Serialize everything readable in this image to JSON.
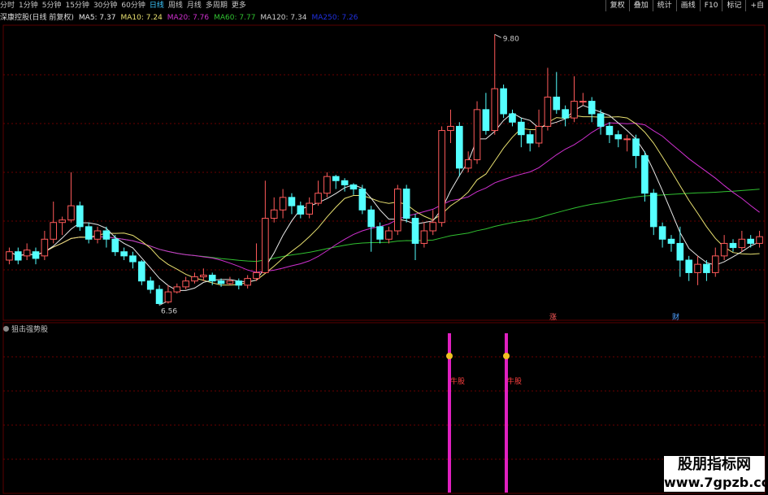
{
  "toolbar": {
    "periods": [
      "分时",
      "1分钟",
      "5分钟",
      "15分钟",
      "30分钟",
      "60分钟",
      "日线",
      "周线",
      "月线",
      "多周期",
      "更多"
    ],
    "active": "日线",
    "right_buttons": [
      "复权",
      "叠加",
      "统计",
      "画线",
      "F10",
      "标记",
      "+自"
    ]
  },
  "legend": {
    "title": "深康控股(日线 前复权)",
    "ma": [
      {
        "label": "MA5: 7.37",
        "color": "#e8e8e8"
      },
      {
        "label": "MA10: 7.24",
        "color": "#e8e070"
      },
      {
        "label": "MA20: 7.76",
        "color": "#d030d0"
      },
      {
        "label": "MA60: 7.77",
        "color": "#30c030"
      },
      {
        "label": "MA120: 7.34",
        "color": "#d0d0d0"
      },
      {
        "label": "MA250: 7.26",
        "color": "#2030e0"
      }
    ]
  },
  "annotations": {
    "high": "9.80",
    "low": "6.56",
    "tag1": "涨",
    "tag2": "财"
  },
  "panel2": {
    "title": "狙击强势股",
    "signal_text": "牛股"
  },
  "watermark": {
    "line1": "股朋指标网",
    "line2": "www.7gpzb.com"
  },
  "colors": {
    "up": "#ff5a5a",
    "down": "#54ffff",
    "grid": "#6a0000",
    "signal": "#e020c0",
    "ma5": "#e8e8e8",
    "ma10": "#e8e070",
    "ma20": "#d030d0",
    "ma60": "#30c030",
    "ma250": "#2030e0"
  },
  "chart_data": {
    "type": "candlestick",
    "ylim": [
      6.4,
      9.9
    ],
    "candles": [
      [
        7.1,
        7.2,
        7.25,
        7.05
      ],
      [
        7.2,
        7.1,
        7.25,
        7.05
      ],
      [
        7.15,
        7.22,
        7.3,
        7.1
      ],
      [
        7.2,
        7.12,
        7.25,
        7.05
      ],
      [
        7.15,
        7.35,
        7.45,
        7.1
      ],
      [
        7.35,
        7.55,
        7.8,
        7.3
      ],
      [
        7.55,
        7.58,
        7.62,
        7.4
      ],
      [
        7.58,
        7.75,
        8.15,
        7.55
      ],
      [
        7.75,
        7.5,
        7.8,
        7.45
      ],
      [
        7.5,
        7.35,
        7.55,
        7.3
      ],
      [
        7.35,
        7.45,
        7.5,
        7.3
      ],
      [
        7.45,
        7.35,
        7.5,
        7.25
      ],
      [
        7.35,
        7.2,
        7.4,
        7.15
      ],
      [
        7.2,
        7.15,
        7.25,
        7.1
      ],
      [
        7.15,
        7.08,
        7.2,
        7.0
      ],
      [
        7.08,
        6.85,
        7.1,
        6.8
      ],
      [
        6.85,
        6.75,
        6.9,
        6.7
      ],
      [
        6.75,
        6.58,
        6.8,
        6.56
      ],
      [
        6.6,
        6.72,
        6.8,
        6.58
      ],
      [
        6.72,
        6.78,
        6.82,
        6.7
      ],
      [
        6.78,
        6.85,
        6.9,
        6.75
      ],
      [
        6.85,
        6.9,
        6.95,
        6.82
      ],
      [
        6.9,
        6.92,
        7.0,
        6.85
      ],
      [
        6.92,
        6.85,
        6.95,
        6.8
      ],
      [
        6.85,
        6.82,
        6.88,
        6.78
      ],
      [
        6.82,
        6.85,
        6.9,
        6.8
      ],
      [
        6.85,
        6.8,
        6.88,
        6.75
      ],
      [
        6.8,
        6.88,
        6.92,
        6.76
      ],
      [
        6.88,
        6.95,
        7.3,
        6.85
      ],
      [
        6.95,
        7.6,
        8.05,
        6.95
      ],
      [
        7.6,
        7.7,
        7.85,
        7.55
      ],
      [
        7.7,
        7.85,
        7.95,
        7.6
      ],
      [
        7.85,
        7.75,
        7.9,
        7.65
      ],
      [
        7.75,
        7.65,
        7.8,
        7.6
      ],
      [
        7.65,
        7.78,
        7.85,
        7.6
      ],
      [
        7.78,
        7.9,
        8.05,
        7.75
      ],
      [
        7.9,
        8.1,
        8.15,
        7.85
      ],
      [
        8.1,
        8.05,
        8.12,
        7.95
      ],
      [
        8.05,
        8.0,
        8.08,
        7.92
      ],
      [
        8.0,
        7.95,
        8.02,
        7.88
      ],
      [
        7.95,
        7.7,
        8.0,
        7.65
      ],
      [
        7.7,
        7.5,
        7.75,
        7.2
      ],
      [
        7.5,
        7.35,
        7.55,
        7.3
      ],
      [
        7.35,
        7.45,
        7.5,
        7.3
      ],
      [
        7.45,
        7.95,
        8.0,
        7.4
      ],
      [
        7.95,
        7.6,
        8.0,
        7.55
      ],
      [
        7.6,
        7.3,
        7.65,
        7.1
      ],
      [
        7.3,
        7.45,
        7.55,
        7.25
      ],
      [
        7.45,
        7.55,
        7.7,
        7.4
      ],
      [
        7.55,
        8.65,
        8.7,
        7.5
      ],
      [
        8.65,
        8.7,
        8.9,
        8.5
      ],
      [
        8.7,
        8.2,
        8.75,
        8.1
      ],
      [
        8.2,
        8.3,
        8.4,
        8.15
      ],
      [
        8.3,
        8.9,
        9.0,
        8.25
      ],
      [
        8.9,
        8.65,
        9.1,
        8.6
      ],
      [
        8.65,
        9.15,
        9.8,
        8.6
      ],
      [
        9.15,
        8.85,
        9.2,
        8.8
      ],
      [
        8.85,
        8.75,
        8.9,
        8.7
      ],
      [
        8.75,
        8.6,
        8.8,
        8.45
      ],
      [
        8.6,
        8.5,
        8.65,
        8.4
      ],
      [
        8.5,
        8.7,
        8.9,
        8.45
      ],
      [
        8.7,
        9.05,
        9.4,
        8.65
      ],
      [
        9.05,
        8.9,
        9.35,
        8.85
      ],
      [
        8.9,
        8.8,
        8.95,
        8.7
      ],
      [
        8.8,
        9.0,
        9.3,
        8.75
      ],
      [
        9.0,
        9.0,
        9.1,
        8.95
      ],
      [
        9.0,
        8.85,
        9.05,
        8.75
      ],
      [
        8.85,
        8.7,
        8.9,
        8.6
      ],
      [
        8.7,
        8.6,
        8.75,
        8.5
      ],
      [
        8.6,
        8.55,
        8.65,
        8.45
      ],
      [
        8.55,
        8.55,
        8.6,
        8.4
      ],
      [
        8.55,
        8.35,
        8.6,
        8.2
      ],
      [
        8.35,
        7.9,
        8.4,
        7.8
      ],
      [
        7.9,
        7.5,
        7.95,
        7.4
      ],
      [
        7.5,
        7.35,
        7.55,
        7.25
      ],
      [
        7.35,
        7.3,
        7.4,
        7.2
      ],
      [
        7.3,
        7.1,
        7.5,
        6.9
      ],
      [
        7.1,
        6.95,
        7.15,
        6.85
      ],
      [
        6.95,
        7.05,
        7.15,
        6.8
      ],
      [
        7.05,
        6.95,
        7.1,
        6.85
      ],
      [
        6.95,
        7.15,
        7.25,
        6.9
      ],
      [
        7.15,
        7.3,
        7.4,
        7.1
      ],
      [
        7.3,
        7.25,
        7.35,
        7.2
      ],
      [
        7.25,
        7.35,
        7.45,
        7.2
      ],
      [
        7.35,
        7.3,
        7.4,
        7.25
      ],
      [
        7.3,
        7.38,
        7.45,
        7.25
      ]
    ],
    "signals": [
      54,
      60
    ]
  }
}
